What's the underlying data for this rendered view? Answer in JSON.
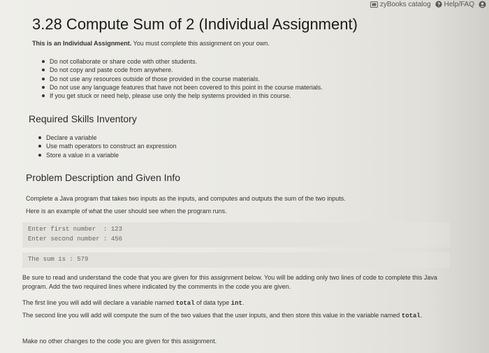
{
  "topbar": {
    "zybooks_label": "zyBooks catalog",
    "help_label": "Help/FAQ"
  },
  "title": "3.28 Compute Sum of 2 (Individual Assignment)",
  "intro": {
    "bold": "This is an Individual Assignment.",
    "rest": " You must complete this assignment on your own."
  },
  "rules": [
    "Do not collaborate or share code with other students.",
    "Do not copy and paste code from anywhere.",
    "Do not use any resources outside of those provided in the course materials.",
    "Do not use any language features that have not been covered to this point in the course materials.",
    "If you get stuck or need help, please use only the help systems provided in this course."
  ],
  "skills": {
    "heading": "Required Skills Inventory",
    "items": [
      "Declare a variable",
      "Use math operators to construct an expression",
      "Store a value in a variable"
    ]
  },
  "problem": {
    "heading": "Problem Description and Given Info",
    "line1": "Complete a Java program that takes two inputs as the inputs, and computes and outputs the sum of the two inputs.",
    "line2": "Here is an example of what the user should see when the program runs."
  },
  "example": {
    "line1": "Enter first number  : 123",
    "line2": "Enter second number : 456",
    "result": "The sum is : 579"
  },
  "instructions": {
    "p1": "Be sure to read and understand the code that you are given for this assignment below. You will be adding only two lines of code to complete this Java program. Add the two required lines where indicated by the comments in the code you are given.",
    "p2_pre": "The first line you will add will declare a variable named ",
    "p2_var": "total",
    "p2_mid": " of data type ",
    "p2_type": "int",
    "p2_end": ".",
    "p3_pre": "The second line you will add will compute the sum of the two values that the user inputs, and then store this value in the variable named ",
    "p3_var": "total",
    "p3_end": ".",
    "p4": "Make no other changes to the code you are given for this assignment."
  }
}
